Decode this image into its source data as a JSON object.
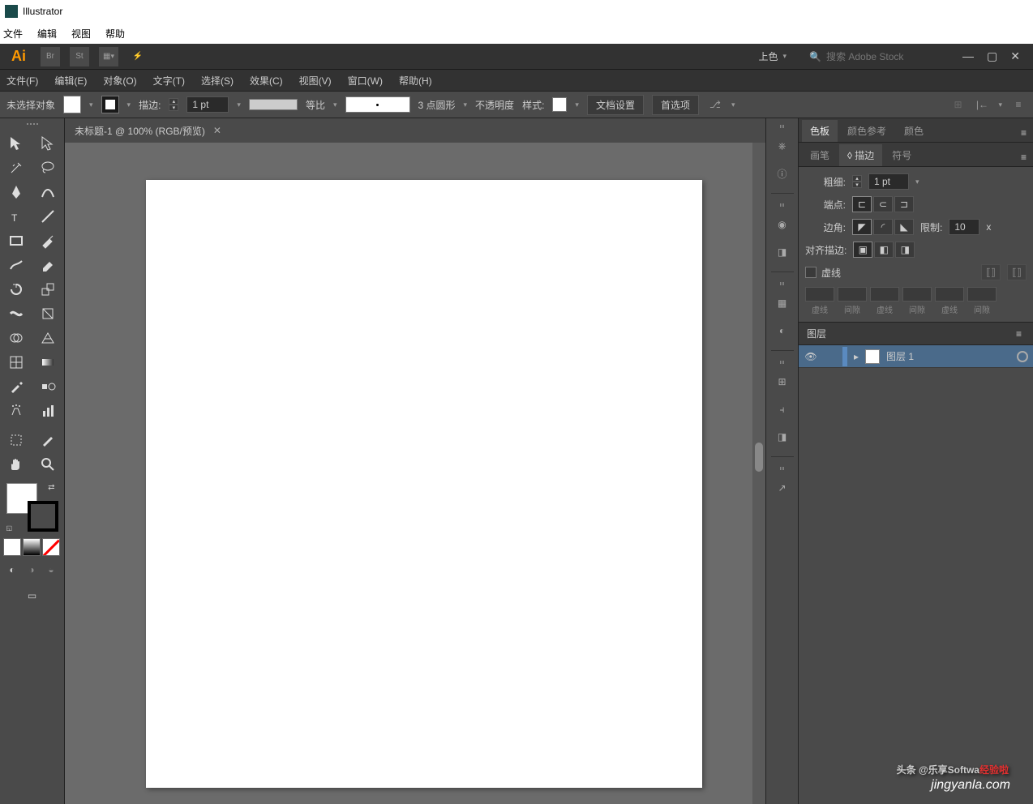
{
  "app": {
    "title": "Illustrator"
  },
  "os_menu": [
    "文件",
    "编辑",
    "视图",
    "帮助"
  ],
  "topbar": {
    "workspace": "上色",
    "search_placeholder": "搜索 Adobe Stock"
  },
  "app_menu": [
    "文件(F)",
    "编辑(E)",
    "对象(O)",
    "文字(T)",
    "选择(S)",
    "效果(C)",
    "视图(V)",
    "窗口(W)",
    "帮助(H)"
  ],
  "control": {
    "no_selection": "未选择对象",
    "stroke_label": "描边:",
    "stroke_value": "1 pt",
    "profile": "等比",
    "brush_label": "3 点圆形",
    "opacity_label": "不透明度",
    "style_label": "样式:",
    "doc_setup": "文档设置",
    "prefs": "首选项"
  },
  "doc_tab": {
    "title": "未标题-1 @ 100% (RGB/预览)"
  },
  "panels": {
    "group1_tabs": [
      "色板",
      "颜色参考",
      "颜色"
    ],
    "group2_tabs": [
      "画笔",
      "描边",
      "符号"
    ],
    "stroke": {
      "weight_label": "粗细:",
      "weight_value": "1 pt",
      "cap_label": "端点:",
      "corner_label": "边角:",
      "limit_label": "限制:",
      "limit_value": "10",
      "limit_suffix": "x",
      "align_label": "对齐描边:",
      "dashed_label": "虚线",
      "dash_cols": [
        "虚线",
        "间隙",
        "虚线",
        "间隙",
        "虚线",
        "间隙"
      ]
    },
    "layers": {
      "title": "图层",
      "layer1": "图层 1"
    }
  },
  "watermark": {
    "line1_a": "头条 @乐享Softwa",
    "line1_b": "经验啦",
    "line2": "jingyanla.com"
  }
}
